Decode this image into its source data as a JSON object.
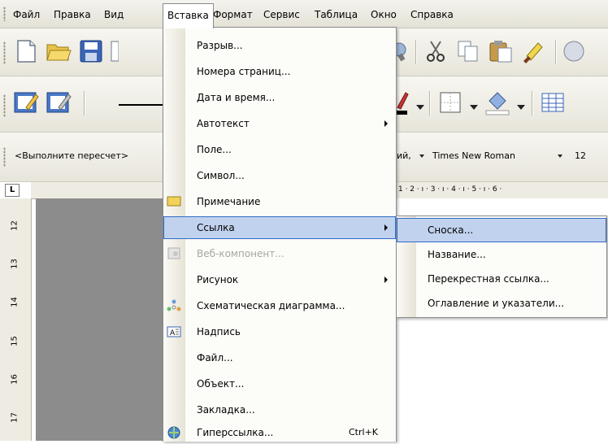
{
  "menubar": {
    "items": [
      {
        "label": "Файл"
      },
      {
        "label": "Правка"
      },
      {
        "label": "Вид"
      },
      {
        "label": "Вставка"
      },
      {
        "label": "Формат"
      },
      {
        "label": "Сервис"
      },
      {
        "label": "Таблица"
      },
      {
        "label": "Окно"
      },
      {
        "label": "Справка"
      }
    ]
  },
  "toolbar": {
    "style_combo": "<Выполните пересчет>",
    "style_combo_tail": "ий,",
    "font_name": "Times New Roman",
    "font_size": "12"
  },
  "ruler": {
    "corner": "L",
    "top_marks": "1 · 2 · ı · 3 · ı · 4 · ı · 5 · ı · 6 ·",
    "left_marks": [
      "12",
      "13",
      "14",
      "15",
      "16",
      "17"
    ]
  },
  "insert_menu": {
    "items": [
      {
        "label": "Разрыв...",
        "icon": ""
      },
      {
        "label": "Номера страниц...",
        "icon": ""
      },
      {
        "label": "Дата и время...",
        "icon": ""
      },
      {
        "label": "Автотекст",
        "icon": "",
        "submenu": true
      },
      {
        "label": "Поле...",
        "icon": ""
      },
      {
        "label": "Символ...",
        "icon": ""
      },
      {
        "label": "Примечание",
        "icon": "comment-icon"
      },
      {
        "label": "Ссылка",
        "icon": "",
        "submenu": true,
        "selected": true
      },
      {
        "label": "Веб-компонент...",
        "icon": "web-component-icon",
        "disabled": true
      },
      {
        "label": "Рисунок",
        "icon": "",
        "submenu": true
      },
      {
        "label": "Схематическая диаграмма...",
        "icon": "diagram-icon"
      },
      {
        "label": "Надпись",
        "icon": "textbox-icon"
      },
      {
        "label": "Файл...",
        "icon": ""
      },
      {
        "label": "Объект...",
        "icon": ""
      },
      {
        "label": "Закладка...",
        "icon": ""
      },
      {
        "label": "Гиперссылка...",
        "icon": "hyperlink-icon",
        "shortcut": "Ctrl+K"
      }
    ]
  },
  "reference_submenu": {
    "items": [
      {
        "label": "Сноска...",
        "selected": true
      },
      {
        "label": "Название..."
      },
      {
        "label": "Перекрестная ссылка..."
      },
      {
        "label": "Оглавление и указатели..."
      }
    ]
  },
  "colors": {
    "highlight": "#c1d2ee",
    "highlight_border": "#316ac5",
    "document_gray": "#8c8c8c"
  }
}
